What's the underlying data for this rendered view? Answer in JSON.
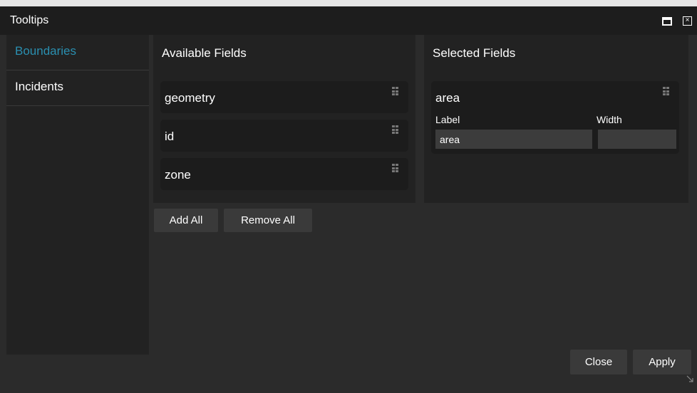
{
  "dialog": {
    "title": "Tooltips",
    "close_symbol": "×"
  },
  "sidebar": {
    "items": [
      {
        "label": "Boundaries"
      },
      {
        "label": "Incidents"
      }
    ]
  },
  "available": {
    "title": "Available Fields",
    "fields": [
      {
        "label": "geometry"
      },
      {
        "label": "id"
      },
      {
        "label": "zone"
      }
    ]
  },
  "selected": {
    "title": "Selected Fields",
    "fields": [
      {
        "name": "area",
        "label_caption": "Label",
        "width_caption": "Width",
        "label_value": "area",
        "width_value": ""
      }
    ]
  },
  "buttons": {
    "add_all": "Add All",
    "remove_all": "Remove All",
    "close": "Close",
    "apply": "Apply"
  },
  "colors": {
    "accent": "#2a8fb0",
    "background": "#2b2b2b",
    "panel": "#222222",
    "titlebar": "#1d1d1d"
  },
  "icons": {
    "maximize": "maximize-icon",
    "close": "close-icon",
    "drag": "drag-handle-icon",
    "resize": "resize-grip-icon"
  }
}
